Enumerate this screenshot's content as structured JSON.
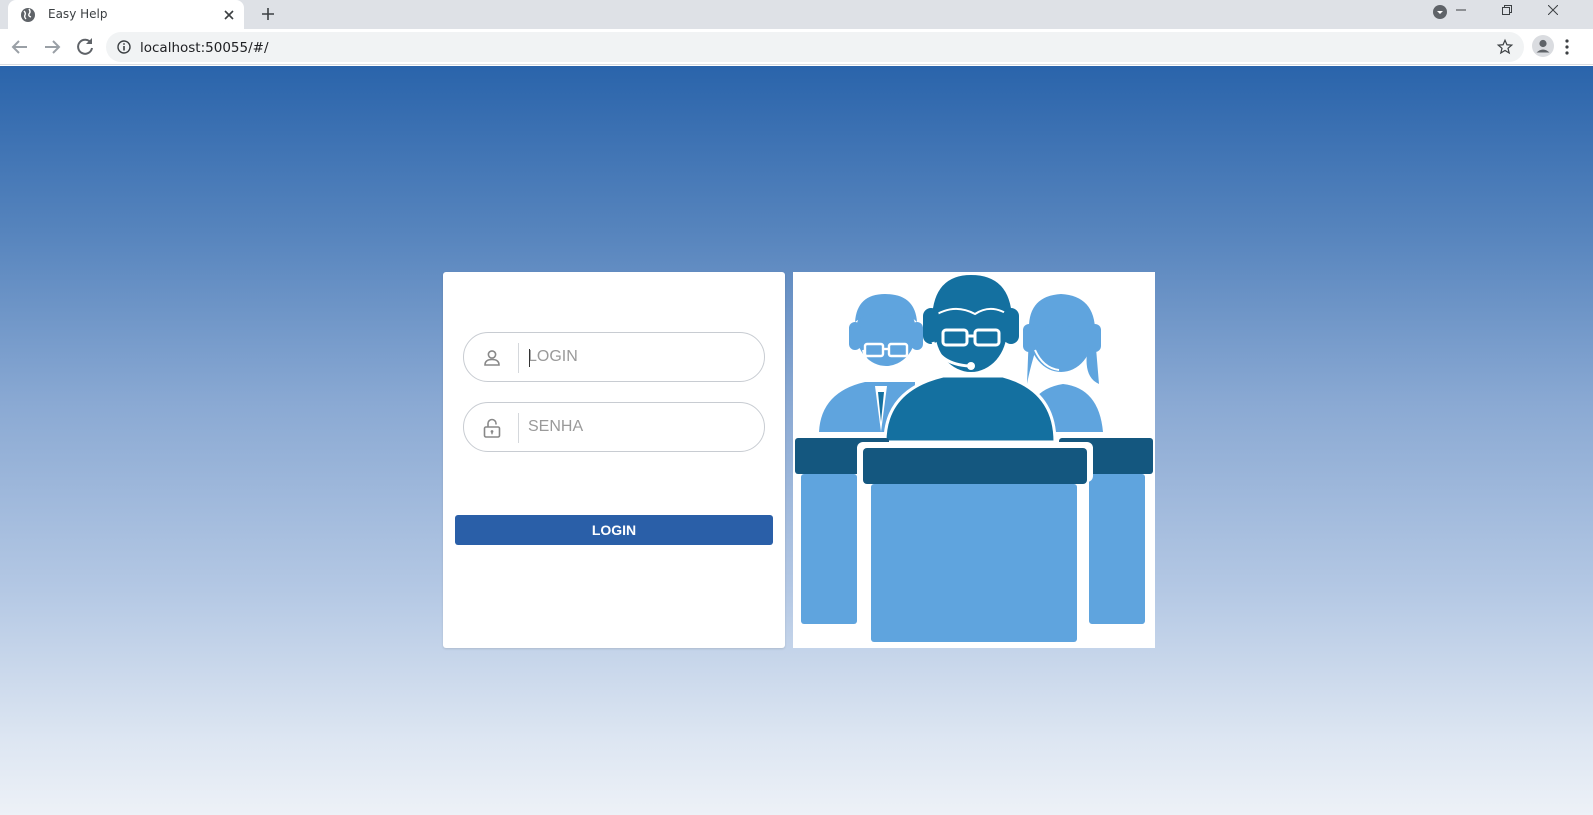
{
  "browser": {
    "tab_title": "Easy Help",
    "url": "localhost:50055/#/"
  },
  "login_form": {
    "login_placeholder": "LOGIN",
    "password_placeholder": "SENHA",
    "submit_label": "LOGIN"
  },
  "colors": {
    "primary_button": "#2a5fa8",
    "gradient_top": "#2a64ab",
    "gradient_bottom": "#edf1f7",
    "illustration_dark": "#14577f",
    "illustration_mid": "#1470a0",
    "illustration_light": "#5fa4de"
  },
  "icons": {
    "login_field": "person-icon",
    "password_field": "lock-icon",
    "illustration": "support-team-illustration"
  }
}
